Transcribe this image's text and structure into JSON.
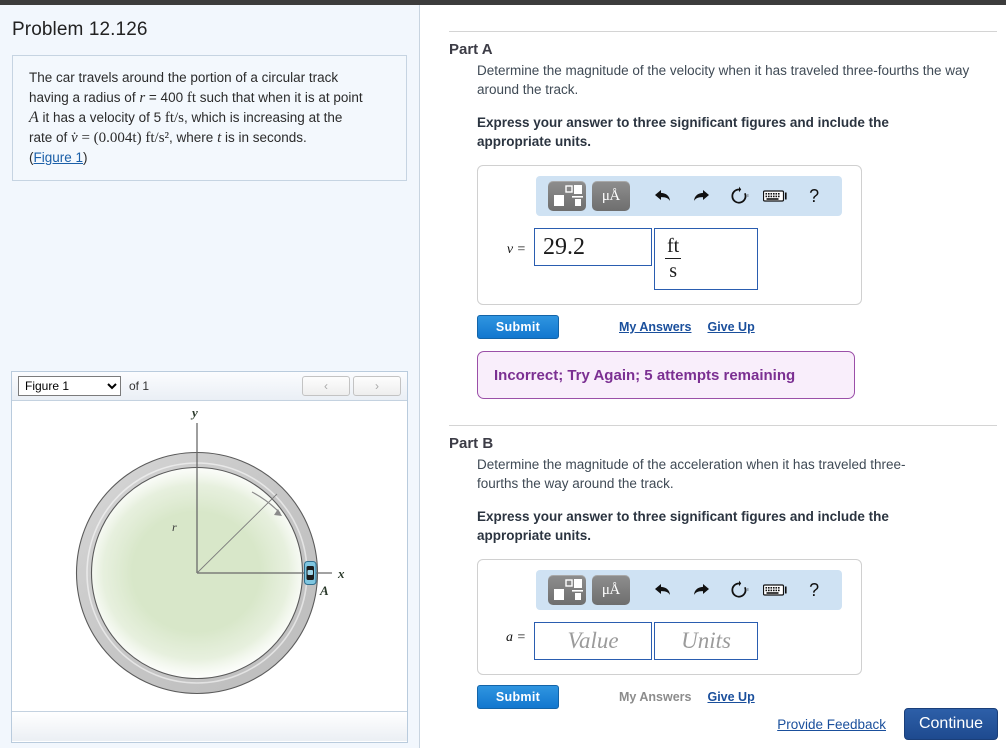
{
  "problem": {
    "title": "Problem 12.126",
    "statement_plain": "The car travels around the portion of a circular track having a radius of r = 400 ft such that when it is at point A it has a velocity of 5 ft/s , which is increasing at the rate of v̇ = (0.004t) ft/s², where t is in seconds.",
    "line1": "The car travels around the portion of a circular track",
    "line2_a": "having a radius of ",
    "line2_r": "r",
    "line2_b": " = 400 ",
    "line2_unit": "ft",
    "line2_c": " such that when it is at point",
    "line3_A": "A",
    "line3_a": " it has a velocity of 5 ",
    "line3_unit": "ft/s",
    "line3_b": ", which is increasing at the",
    "line4_a": "rate of ",
    "line4_vdot": "v̇",
    "line4_eq": " = ",
    "line4_expr": "(0.004t)",
    "line4_unit": "ft/s²",
    "line4_b": ", where ",
    "line4_t": "t",
    "line4_c": " is in seconds.",
    "figure_link": "Figure 1",
    "paren_open": "(",
    "paren_close": ")"
  },
  "figure_panel": {
    "selected_figure": "Figure 1",
    "options": [
      "Figure 1"
    ],
    "count_label": "of 1",
    "prev_glyph": "‹",
    "next_glyph": "›",
    "diagram": {
      "axis_x_label": "x",
      "axis_y_label": "y",
      "radius_label": "r",
      "point_label": "A",
      "track_color": "#c9c9c9",
      "ground_color": "#d7e6c8",
      "car_color": "#2f8fbf"
    }
  },
  "parts": [
    {
      "heading": "Part A",
      "question": "Determine the magnitude of the velocity when it has traveled three-fourths the way around the track.",
      "instruction": "Express your answer to three significant figures and include the appropriate units.",
      "variable": "v =",
      "value": "29.2",
      "value_placeholder": "Value",
      "units_numerator": "ft",
      "units_denominator": "s",
      "units_placeholder": "Units",
      "has_units_fraction": true,
      "submit_label": "Submit",
      "my_answers_label": "My Answers",
      "my_answers_active": true,
      "give_up_label": "Give Up",
      "alert": "Incorrect; Try Again; 5 attempts remaining"
    },
    {
      "heading": "Part B",
      "question": "Determine the magnitude of the acceleration when it has traveled three-fourths the way around the track.",
      "instruction": "Express your answer to three significant figures and include the appropriate units.",
      "variable": "a =",
      "value": "",
      "value_placeholder": "Value",
      "units_numerator": "",
      "units_denominator": "",
      "units_placeholder": "Units",
      "has_units_fraction": false,
      "submit_label": "Submit",
      "my_answers_label": "My Answers",
      "my_answers_active": false,
      "give_up_label": "Give Up",
      "alert": ""
    }
  ],
  "toolbar": {
    "template_icon": "template-icon",
    "units_icon": "μÅ",
    "undo_icon": "undo-icon",
    "redo_icon": "redo-icon",
    "reset_icon": "reset-icon",
    "keyboard_icon": "keyboard-icon",
    "help_icon": "?"
  },
  "footer": {
    "provide_feedback": "Provide Feedback",
    "continue_label": "Continue"
  },
  "colors": {
    "accent_blue": "#1277cf",
    "link_blue": "#1a4f9c",
    "alert_border": "#9b4fa8",
    "alert_bg": "#f9eefb",
    "alert_text": "#7b2f92",
    "toolbar_bg": "#cfe2f3",
    "left_panel_bg": "#f2f7fd",
    "continue_blue": "#2d5fa8"
  }
}
